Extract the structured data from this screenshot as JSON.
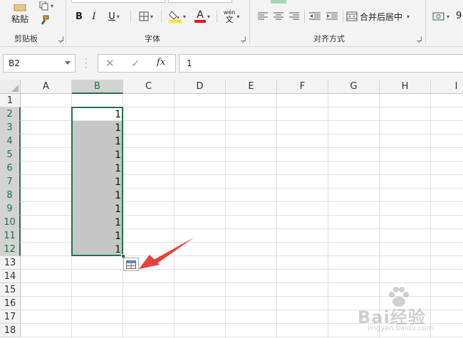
{
  "ribbon": {
    "clipboard": {
      "label": "剪贴板",
      "paste_label": "粘贴"
    },
    "font": {
      "label": "字体",
      "bold": "B",
      "italic": "I",
      "underline": "U",
      "color_letter": "A",
      "phonetic_top": "wén",
      "phonetic_bottom": "文"
    },
    "alignment": {
      "label": "对齐方式",
      "merge_label": "合并后居中"
    },
    "number": {
      "partial_label": "9"
    },
    "colors": {
      "highlight": "#ffe600",
      "font_color": "#e81123",
      "accent_green": "#217346"
    }
  },
  "formula_bar": {
    "name_box": "B2",
    "fx_label": "fx",
    "value": "1"
  },
  "grid": {
    "columns": [
      "A",
      "B",
      "C",
      "D",
      "E",
      "F",
      "G",
      "H",
      "I"
    ],
    "selected_column": "B",
    "rows": [
      "1",
      "2",
      "3",
      "4",
      "5",
      "6",
      "7",
      "8",
      "9",
      "10",
      "11",
      "12",
      "13",
      "14",
      "15",
      "16",
      "17",
      "18"
    ],
    "selected_rows": [
      "2",
      "3",
      "4",
      "5",
      "6",
      "7",
      "8",
      "9",
      "10",
      "11",
      "12"
    ],
    "cells": [
      {
        "ref": "B2",
        "value": "1"
      },
      {
        "ref": "B3",
        "value": "1"
      },
      {
        "ref": "B4",
        "value": "1"
      },
      {
        "ref": "B5",
        "value": "1"
      },
      {
        "ref": "B6",
        "value": "1"
      },
      {
        "ref": "B7",
        "value": "1"
      },
      {
        "ref": "B8",
        "value": "1"
      },
      {
        "ref": "B9",
        "value": "1"
      },
      {
        "ref": "B10",
        "value": "1"
      },
      {
        "ref": "B11",
        "value": "1"
      },
      {
        "ref": "B12",
        "value": "1"
      }
    ]
  },
  "watermark": {
    "text": "Bai经验",
    "subtext": "jingyan.baidu.com"
  }
}
